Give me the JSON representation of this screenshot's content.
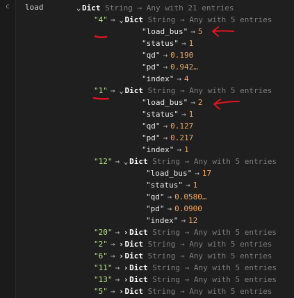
{
  "gutter_label": "c",
  "var_name": "load",
  "symbols": {
    "arrow": "→",
    "expanded": "⌄",
    "collapsed": "›",
    "ellipsis": "…"
  },
  "root": {
    "type": "Dict",
    "type_params": "String → Any with 21 entries"
  },
  "entries": [
    {
      "key": "\"4\"",
      "type": "Dict",
      "type_params": "String → Any with 5 entries",
      "expanded": true,
      "fields": [
        {
          "name": "\"load_bus\"",
          "value": "5"
        },
        {
          "name": "\"status\"",
          "value": "1"
        },
        {
          "name": "\"qd\"",
          "value": "0.190"
        },
        {
          "name": "\"pd\"",
          "value": "0.942…"
        },
        {
          "name": "\"index\"",
          "value": "4"
        }
      ]
    },
    {
      "key": "\"1\"",
      "type": "Dict",
      "type_params": "String → Any with 5 entries",
      "expanded": true,
      "fields": [
        {
          "name": "\"load_bus\"",
          "value": "2"
        },
        {
          "name": "\"status\"",
          "value": "1"
        },
        {
          "name": "\"qd\"",
          "value": "0.127"
        },
        {
          "name": "\"pd\"",
          "value": "0.217"
        },
        {
          "name": "\"index\"",
          "value": "1"
        }
      ]
    },
    {
      "key": "\"12\"",
      "type": "Dict",
      "type_params": "String → Any with 5 entries",
      "expanded": true,
      "fields": [
        {
          "name": "\"load_bus\"",
          "value": "17"
        },
        {
          "name": "\"status\"",
          "value": "1"
        },
        {
          "name": "\"qd\"",
          "value": "0.0580…"
        },
        {
          "name": "\"pd\"",
          "value": "0.0900"
        },
        {
          "name": "\"index\"",
          "value": "12"
        }
      ]
    },
    {
      "key": "\"20\"",
      "type": "Dict",
      "type_params": "String → Any with 5 entries",
      "expanded": false
    },
    {
      "key": "\"2\"",
      "type": "Dict",
      "type_params": "String → Any with 5 entries",
      "expanded": false
    },
    {
      "key": "\"6\"",
      "type": "Dict",
      "type_params": "String → Any with 5 entries",
      "expanded": false
    },
    {
      "key": "\"11\"",
      "type": "Dict",
      "type_params": "String → Any with 5 entries",
      "expanded": false
    },
    {
      "key": "\"13\"",
      "type": "Dict",
      "type_params": "String → Any with 5 entries",
      "expanded": false
    },
    {
      "key": "\"5\"",
      "type": "Dict",
      "type_params": "String → Any with 5 entries",
      "expanded": false
    }
  ],
  "annotation_color": "#e0141e"
}
